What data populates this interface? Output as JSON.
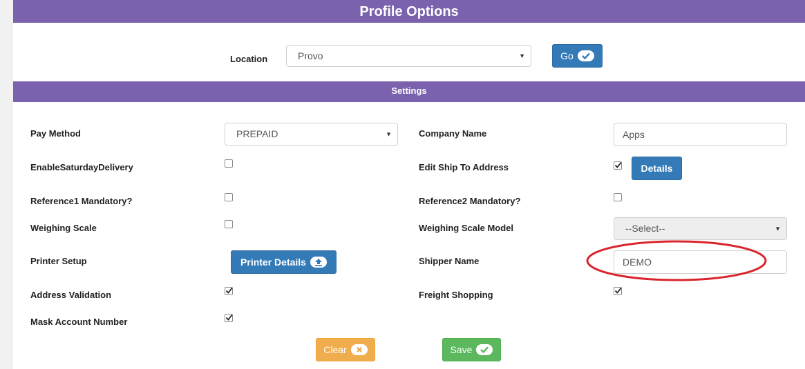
{
  "header": {
    "title": "Profile Options"
  },
  "location": {
    "label": "Location",
    "value": "Provo",
    "go_label": "Go"
  },
  "settings": {
    "title": "Settings"
  },
  "fields": {
    "pay_method": {
      "label": "Pay Method",
      "value": "PREPAID"
    },
    "company_name": {
      "label": "Company Name",
      "value": "Apps"
    },
    "enable_saturday_delivery": {
      "label": "EnableSaturdayDelivery",
      "checked": false
    },
    "edit_ship_to_address": {
      "label": "Edit Ship To Address",
      "checked": true,
      "details_label": "Details"
    },
    "reference1_mandatory": {
      "label": "Reference1 Mandatory?",
      "checked": false
    },
    "reference2_mandatory": {
      "label": "Reference2 Mandatory?",
      "checked": false
    },
    "weighing_scale": {
      "label": "Weighing Scale",
      "checked": false
    },
    "weighing_scale_model": {
      "label": "Weighing Scale Model",
      "value": "--Select--"
    },
    "printer_setup": {
      "label": "Printer Setup",
      "button_label": "Printer Details"
    },
    "shipper_name": {
      "label": "Shipper Name",
      "value": "DEMO"
    },
    "address_validation": {
      "label": "Address Validation",
      "checked": true
    },
    "freight_shopping": {
      "label": "Freight Shopping",
      "checked": true
    },
    "mask_account_number": {
      "label": "Mask Account Number",
      "checked": true
    }
  },
  "actions": {
    "clear_label": "Clear",
    "save_label": "Save"
  },
  "colors": {
    "header": "#7a62ae",
    "primary": "#337ab7",
    "warning": "#f0ad4e",
    "success": "#5cb85c",
    "annotation": "#d9242b"
  }
}
